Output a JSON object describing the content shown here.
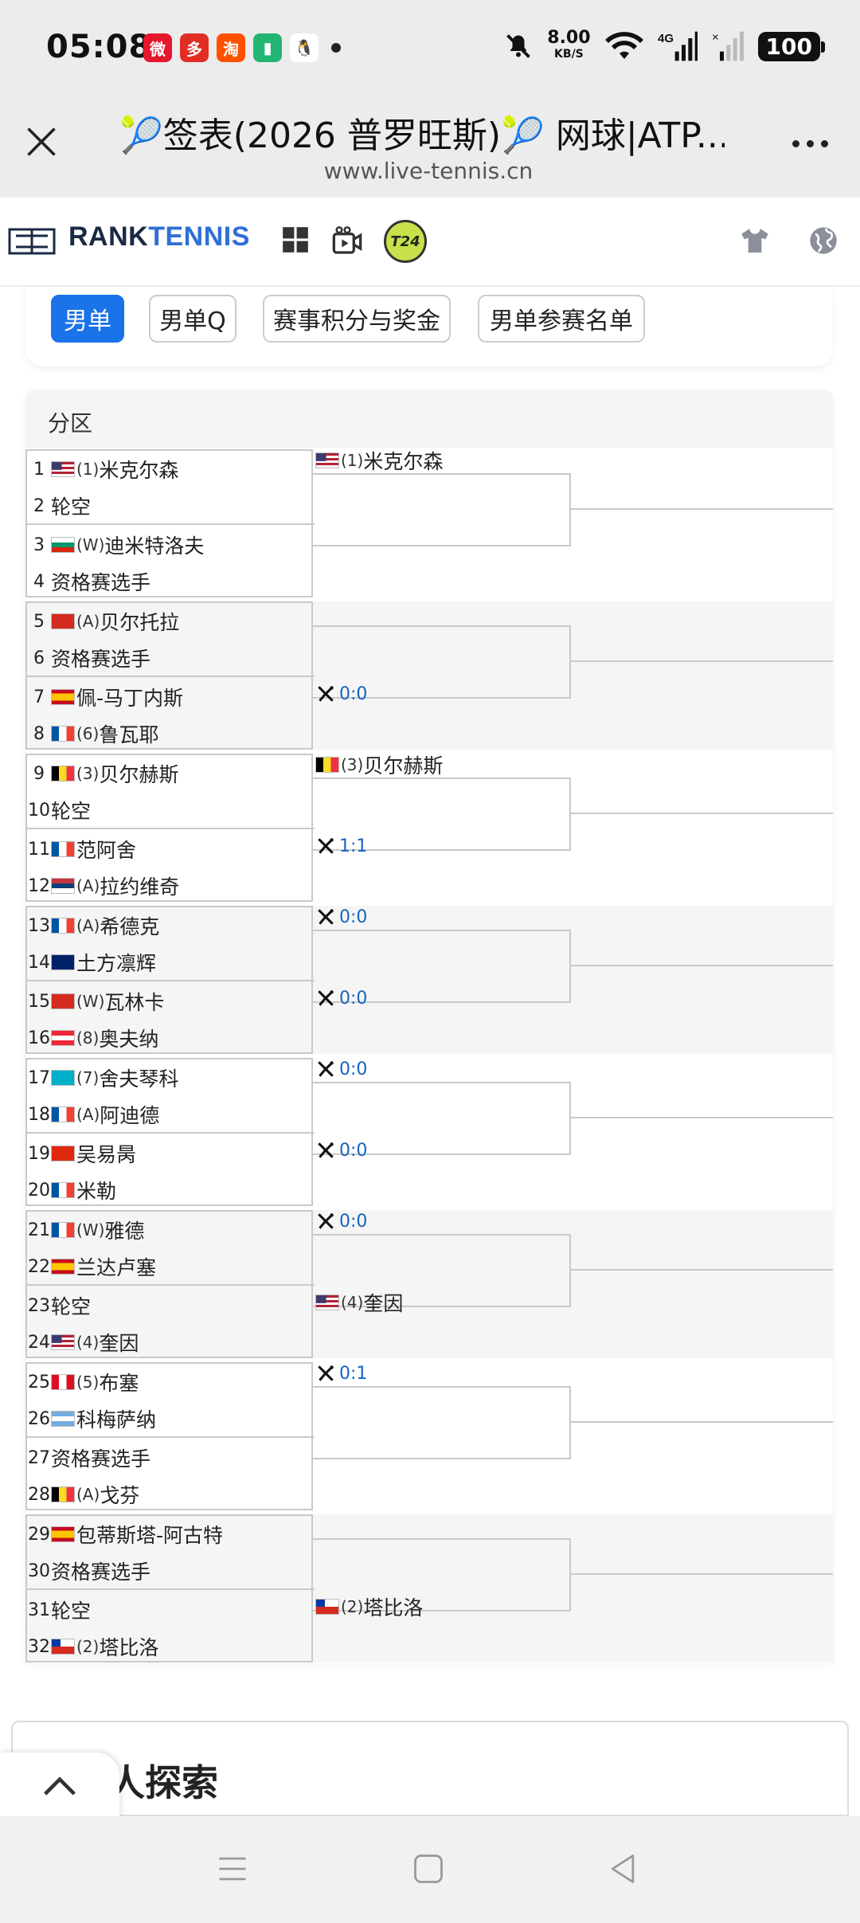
{
  "status_bar": {
    "time": "05:08",
    "apps": [
      {
        "name": "weibo-icon",
        "bg": "#e6162d",
        "glyph": "微"
      },
      {
        "name": "pdd-icon",
        "bg": "#e02e24",
        "glyph": "多"
      },
      {
        "name": "taobao-icon",
        "bg": "#ff5000",
        "glyph": "淘"
      },
      {
        "name": "battery-app-icon",
        "bg": "#22b573",
        "glyph": "▮"
      },
      {
        "name": "qq-icon",
        "bg": "#ffffff",
        "glyph": "🐧"
      }
    ],
    "net_speed": "8.00",
    "net_unit": "KB/S",
    "network": "4G",
    "battery": "100"
  },
  "browser": {
    "title": "🎾签表(2026 普罗旺斯)🎾 网球|ATP...",
    "url": "www.live-tennis.cn"
  },
  "site": {
    "logo_rank": "RANK",
    "logo_tennis": "TENNIS",
    "t24_label": "T24"
  },
  "tabs": [
    {
      "label": "男单",
      "active": true
    },
    {
      "label": "男单Q",
      "active": false
    },
    {
      "label": "赛事积分与奖金",
      "active": false
    },
    {
      "label": "男单参赛名单",
      "active": false
    }
  ],
  "bracket": {
    "header": "分区",
    "groups": [
      {
        "players": [
          {
            "num": "1",
            "flag": "us",
            "seed": "(1)",
            "name": "米克尔森"
          },
          {
            "num": "2",
            "flag": "",
            "seed": "",
            "name": "轮空"
          },
          {
            "num": "3",
            "flag": "bg",
            "seed": "(W)",
            "name": "迪米特洛夫"
          },
          {
            "num": "4",
            "flag": "",
            "seed": "",
            "name": "资格赛选手"
          }
        ],
        "r2": [
          {
            "flag": "us",
            "seed": "(1)",
            "name": "米克尔森",
            "h2h": ""
          },
          {
            "flag": "",
            "seed": "",
            "name": "",
            "h2h": ""
          }
        ]
      },
      {
        "players": [
          {
            "num": "5",
            "flag": "ch",
            "seed": "(A)",
            "name": "贝尔托拉"
          },
          {
            "num": "6",
            "flag": "",
            "seed": "",
            "name": "资格赛选手"
          },
          {
            "num": "7",
            "flag": "es",
            "seed": "",
            "name": "佩-马丁内斯"
          },
          {
            "num": "8",
            "flag": "fr",
            "seed": "(6)",
            "name": "鲁瓦耶"
          }
        ],
        "r2": [
          {
            "flag": "",
            "seed": "",
            "name": "",
            "h2h": ""
          },
          {
            "flag": "",
            "seed": "",
            "name": "",
            "h2h": "0:0"
          }
        ]
      },
      {
        "players": [
          {
            "num": "9",
            "flag": "be",
            "seed": "(3)",
            "name": "贝尔赫斯"
          },
          {
            "num": "10",
            "flag": "",
            "seed": "",
            "name": "轮空"
          },
          {
            "num": "11",
            "flag": "fr",
            "seed": "",
            "name": "范阿舍"
          },
          {
            "num": "12",
            "flag": "rs",
            "seed": "(A)",
            "name": "拉约维奇"
          }
        ],
        "r2": [
          {
            "flag": "be",
            "seed": "(3)",
            "name": "贝尔赫斯",
            "h2h": ""
          },
          {
            "flag": "",
            "seed": "",
            "name": "",
            "h2h": "1:1"
          }
        ]
      },
      {
        "players": [
          {
            "num": "13",
            "flag": "fr",
            "seed": "(A)",
            "name": "希德克"
          },
          {
            "num": "14",
            "flag": "au",
            "seed": "",
            "name": "土方凛辉"
          },
          {
            "num": "15",
            "flag": "ch",
            "seed": "(W)",
            "name": "瓦林卡"
          },
          {
            "num": "16",
            "flag": "at",
            "seed": "(8)",
            "name": "奥夫纳"
          }
        ],
        "r2": [
          {
            "flag": "",
            "seed": "",
            "name": "",
            "h2h": "0:0"
          },
          {
            "flag": "",
            "seed": "",
            "name": "",
            "h2h": "0:0"
          }
        ]
      },
      {
        "players": [
          {
            "num": "17",
            "flag": "kz",
            "seed": "(7)",
            "name": "舍夫琴科"
          },
          {
            "num": "18",
            "flag": "fr",
            "seed": "(A)",
            "name": "阿迪德"
          },
          {
            "num": "19",
            "flag": "cn",
            "seed": "",
            "name": "吴易昺"
          },
          {
            "num": "20",
            "flag": "fr",
            "seed": "",
            "name": "米勒"
          }
        ],
        "r2": [
          {
            "flag": "",
            "seed": "",
            "name": "",
            "h2h": "0:0"
          },
          {
            "flag": "",
            "seed": "",
            "name": "",
            "h2h": "0:0"
          }
        ]
      },
      {
        "players": [
          {
            "num": "21",
            "flag": "fr",
            "seed": "(W)",
            "name": "雅德"
          },
          {
            "num": "22",
            "flag": "es",
            "seed": "",
            "name": "兰达卢塞"
          },
          {
            "num": "23",
            "flag": "",
            "seed": "",
            "name": "轮空"
          },
          {
            "num": "24",
            "flag": "us",
            "seed": "(4)",
            "name": "奎因"
          }
        ],
        "r2": [
          {
            "flag": "",
            "seed": "",
            "name": "",
            "h2h": "0:0"
          },
          {
            "flag": "us",
            "seed": "(4)",
            "name": "奎因",
            "h2h": ""
          }
        ]
      },
      {
        "players": [
          {
            "num": "25",
            "flag": "pe",
            "seed": "(5)",
            "name": "布塞"
          },
          {
            "num": "26",
            "flag": "ar",
            "seed": "",
            "name": "科梅萨纳"
          },
          {
            "num": "27",
            "flag": "",
            "seed": "",
            "name": "资格赛选手"
          },
          {
            "num": "28",
            "flag": "be",
            "seed": "(A)",
            "name": "戈芬"
          }
        ],
        "r2": [
          {
            "flag": "",
            "seed": "",
            "name": "",
            "h2h": "0:1"
          },
          {
            "flag": "",
            "seed": "",
            "name": "",
            "h2h": ""
          }
        ]
      },
      {
        "players": [
          {
            "num": "29",
            "flag": "es",
            "seed": "",
            "name": "包蒂斯塔-阿古特"
          },
          {
            "num": "30",
            "flag": "",
            "seed": "",
            "name": "资格赛选手"
          },
          {
            "num": "31",
            "flag": "",
            "seed": "",
            "name": "轮空"
          },
          {
            "num": "32",
            "flag": "cl",
            "seed": "(2)",
            "name": "塔比洛"
          }
        ],
        "r2": [
          {
            "flag": "",
            "seed": "",
            "name": "",
            "h2h": ""
          },
          {
            "flag": "cl",
            "seed": "(2)",
            "name": "塔比洛",
            "h2h": ""
          }
        ]
      }
    ]
  },
  "explore": {
    "title": "人探索"
  },
  "colors": {
    "accent": "#1a73e8",
    "h2h_blue": "#1565c0",
    "logo_dark": "#1a2a44",
    "logo_blue": "#2f6fd6"
  }
}
